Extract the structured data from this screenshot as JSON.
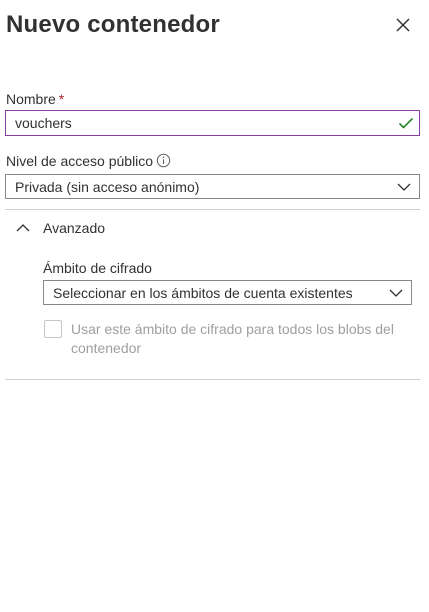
{
  "panel": {
    "title": "Nuevo contenedor",
    "close_icon": "close-icon"
  },
  "name_field": {
    "label": "Nombre",
    "required_marker": "*",
    "value": "vouchers",
    "valid_icon": "checkmark-icon",
    "border_color": "#8a3fa0",
    "valid_color": "#107c10"
  },
  "access_level": {
    "label": "Nivel de acceso público",
    "info_icon": "info-icon",
    "selected": "Privada (sin acceso anónimo)"
  },
  "advanced": {
    "label": "Avanzado",
    "expanded": true,
    "encryption_scope": {
      "label": "Ámbito de cifrado",
      "selected": "Seleccionar en los ámbitos de cuenta existentes"
    },
    "apply_to_all": {
      "label": "Usar este ámbito de cifrado para todos los blobs del contenedor",
      "checked": false,
      "disabled": true
    }
  }
}
